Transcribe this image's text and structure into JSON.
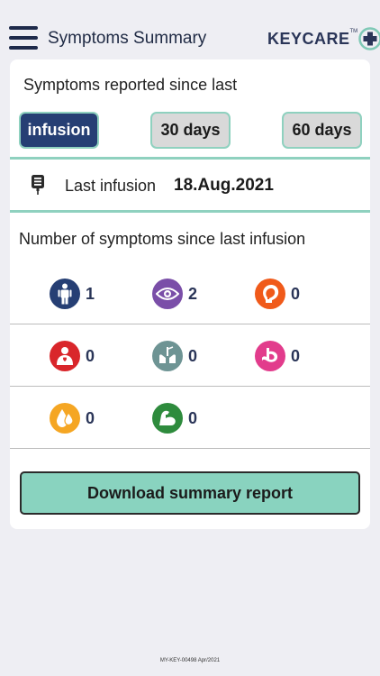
{
  "header": {
    "title": "Symptoms Summary",
    "logo_text": "KEYCARE",
    "logo_tm": "TM"
  },
  "reported": {
    "title": "Symptoms reported since last",
    "buttons": [
      {
        "label": "infusion",
        "active": true
      },
      {
        "label": "30 days",
        "active": false
      },
      {
        "label": "60 days",
        "active": false
      }
    ]
  },
  "last_infusion": {
    "label": "Last infusion",
    "date": "18.Aug.2021"
  },
  "symptoms": {
    "title": "Number of symptoms since last infusion",
    "items": [
      {
        "icon": "person-icon",
        "color": "#263f74",
        "count": "1"
      },
      {
        "icon": "eye-icon",
        "color": "#7a4ea8",
        "count": "2"
      },
      {
        "icon": "head-icon",
        "color": "#f05a1a",
        "count": "0"
      },
      {
        "icon": "chest-icon",
        "color": "#d9262b",
        "count": "0"
      },
      {
        "icon": "lungs-icon",
        "color": "#6e9494",
        "count": "0"
      },
      {
        "icon": "stomach-icon",
        "color": "#e23c8c",
        "count": "0"
      },
      {
        "icon": "drop-icon",
        "color": "#f5a623",
        "count": "0"
      },
      {
        "icon": "muscle-icon",
        "color": "#2e8b3d",
        "count": "0"
      }
    ]
  },
  "download": {
    "label": "Download summary report"
  },
  "footer": {
    "code": "MY-KEY-00498 Apr/2021"
  },
  "colors": {
    "accent": "#8fd1bf",
    "primary": "#263f74",
    "background": "#eeeef3"
  }
}
